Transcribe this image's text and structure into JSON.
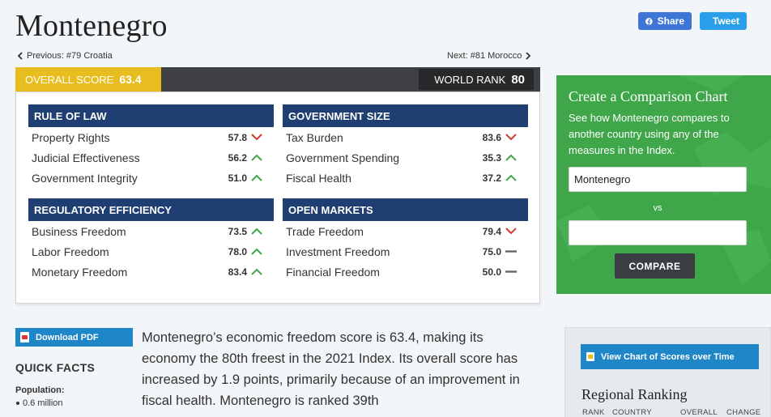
{
  "page": {
    "country": "Montenegro",
    "share_label": "Share",
    "tweet_label": "Tweet",
    "prev_label": "Previous: #79 Croatia",
    "next_label": "Next: #81 Morocco"
  },
  "scores": {
    "overall_label": "OVERALL SCORE",
    "overall_value": "63.4",
    "rank_label": "WORLD RANK",
    "rank_value": "80"
  },
  "categories": [
    {
      "title": "RULE OF LAW",
      "items": [
        {
          "label": "Property Rights",
          "value": "57.8",
          "trend": "down"
        },
        {
          "label": "Judicial Effectiveness",
          "value": "56.2",
          "trend": "up"
        },
        {
          "label": "Government Integrity",
          "value": "51.0",
          "trend": "up"
        }
      ]
    },
    {
      "title": "GOVERNMENT SIZE",
      "items": [
        {
          "label": "Tax Burden",
          "value": "83.6",
          "trend": "down"
        },
        {
          "label": "Government Spending",
          "value": "35.3",
          "trend": "up"
        },
        {
          "label": "Fiscal Health",
          "value": "37.2",
          "trend": "up"
        }
      ]
    },
    {
      "title": "REGULATORY EFFICIENCY",
      "items": [
        {
          "label": "Business Freedom",
          "value": "73.5",
          "trend": "up"
        },
        {
          "label": "Labor Freedom",
          "value": "78.0",
          "trend": "up"
        },
        {
          "label": "Monetary Freedom",
          "value": "83.4",
          "trend": "up"
        }
      ]
    },
    {
      "title": "OPEN MARKETS",
      "items": [
        {
          "label": "Trade Freedom",
          "value": "79.4",
          "trend": "down"
        },
        {
          "label": "Investment Freedom",
          "value": "75.0",
          "trend": "flat"
        },
        {
          "label": "Financial Freedom",
          "value": "50.0",
          "trend": "flat"
        }
      ]
    }
  ],
  "colors": {
    "up": "#3fa64a",
    "down": "#d23a2c",
    "flat": "#666666",
    "header_navy": "#1f3f72",
    "overall_gold": "#e8bd1f",
    "compare_green": "#3fa64a"
  },
  "compare": {
    "title": "Create a Comparison Chart",
    "description": "See how Montenegro compares to another country using any of the measures in the Index.",
    "country_a_value": "Montenegro",
    "country_b_value": "",
    "vs_label": "vs",
    "button_label": "COMPARE"
  },
  "sidebar_left": {
    "pdf_button": "Download PDF",
    "quick_facts_title": "QUICK FACTS",
    "population_label": "Population:",
    "population_value": "0.6 million"
  },
  "summary_text": "Montenegro’s economic freedom score is 63.4, making its economy the 80th freest in the 2021 Index. Its overall score has increased by 1.9 points, primarily because of an improvement in fiscal health. Montenegro is ranked 39th",
  "side_panel": {
    "chart_button": "View Chart of Scores over Time",
    "regional_title": "Regional Ranking",
    "headers": {
      "rank": "RANK",
      "country": "COUNTRY",
      "overall": "OVERALL",
      "change": "CHANGE"
    }
  }
}
